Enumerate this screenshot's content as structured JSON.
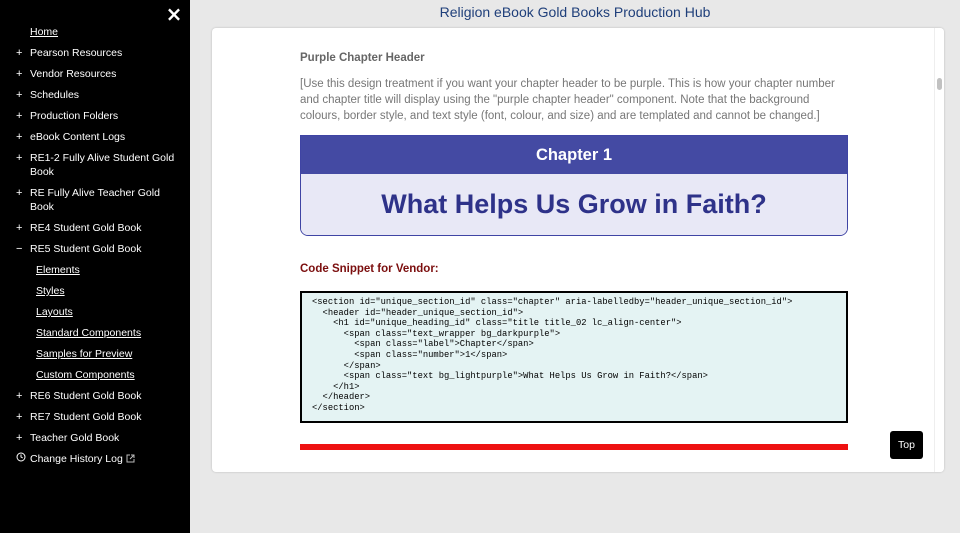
{
  "header": {
    "title": "Religion eBook Gold Books Production Hub"
  },
  "sidebar": {
    "close_icon": "×",
    "items": [
      {
        "prefix": "",
        "label": "Home",
        "style": "plain"
      },
      {
        "prefix": "+",
        "label": "Pearson Resources"
      },
      {
        "prefix": "+",
        "label": "Vendor Resources"
      },
      {
        "prefix": "+",
        "label": "Schedules"
      },
      {
        "prefix": "+",
        "label": "Production Folders"
      },
      {
        "prefix": "+",
        "label": "eBook Content Logs"
      },
      {
        "prefix": "+",
        "label": "RE1-2 Fully Alive Student Gold Book"
      },
      {
        "prefix": "+",
        "label": "RE Fully Alive Teacher Gold Book"
      },
      {
        "prefix": "+",
        "label": "RE4 Student Gold Book"
      },
      {
        "prefix": "−",
        "label": "RE5 Student Gold Book"
      }
    ],
    "subitems": [
      "Elements",
      "Styles",
      "Layouts",
      "Standard Components",
      "Samples for Preview",
      "Custom Components"
    ],
    "items_after": [
      {
        "prefix": "+",
        "label": "RE6 Student Gold Book"
      },
      {
        "prefix": "+",
        "label": "RE7 Student Gold Book"
      },
      {
        "prefix": "+",
        "label": "Teacher Gold Book"
      }
    ],
    "history": {
      "label": "Change History Log",
      "icon": "clock-icon",
      "link_icon": "external-link-icon"
    }
  },
  "main": {
    "section_heading": "Purple Chapter Header",
    "section_desc": "[Use this design treatment if you want your chapter header to be purple. This is how your chapter number and chapter title will display using the \"purple chapter header\" component. Note that the background colours, border style, and text style (font, colour, and size) and are templated and cannot be changed.]",
    "chapter_label": "Chapter 1",
    "chapter_title": "What Helps Us Grow in Faith?",
    "snippet_label": "Code Snippet for Vendor:",
    "code": "<section id=\"unique_section_id\" class=\"chapter\" aria-labelledby=\"header_unique_section_id\">\n  <header id=\"header_unique_section_id\">\n    <h1 id=\"unique_heading_id\" class=\"title title_02 lc_align-center\">\n      <span class=\"text_wrapper bg_darkpurple\">\n        <span class=\"label\">Chapter</span>\n        <span class=\"number\">1</span>\n      </span>\n      <span class=\"text bg_lightpurple\">What Helps Us Grow in Faith?</span>\n    </h1>\n  </header>\n</section>"
  },
  "top_button": {
    "label": "Top"
  },
  "colors": {
    "sidebar_bg": "#000000",
    "chapter_dark": "#444aa3",
    "chapter_light": "#e8e8f6",
    "chapter_text": "#2e3289",
    "snippet_label": "#7b0e0e",
    "code_bg": "#e4f3f3",
    "red_bar": "#ee1111"
  }
}
